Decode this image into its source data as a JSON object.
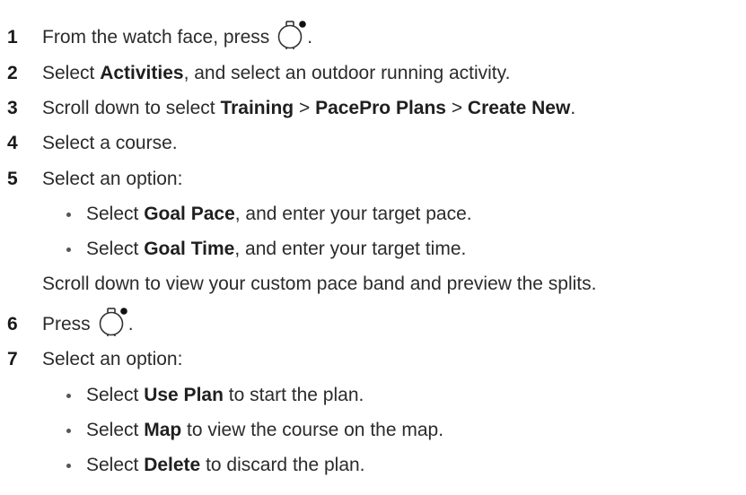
{
  "steps": [
    {
      "num": "1",
      "text": "From the watch face, press",
      "after": "."
    },
    {
      "num": "2",
      "pre": "Select ",
      "bold": "Activities",
      "post": ", and select an outdoor running activity."
    },
    {
      "num": "3",
      "pre": "Scroll down to select ",
      "b1": "Training",
      "sep1": " > ",
      "b2": "PacePro Plans",
      "sep2": " > ",
      "b3": "Create New",
      "post": "."
    },
    {
      "num": "4",
      "text": "Select a course."
    },
    {
      "num": "5",
      "text": "Select an option:"
    },
    {
      "num": "6",
      "text": "Press",
      "after": "."
    },
    {
      "num": "7",
      "text": "Select an option:"
    }
  ],
  "step5_bullets": [
    {
      "pre": "Select ",
      "bold": "Goal Pace",
      "post": ", and enter your target pace."
    },
    {
      "pre": "Select ",
      "bold": "Goal Time",
      "post": ", and enter your target time."
    }
  ],
  "step5_note": "Scroll down to view your custom pace band and preview the splits.",
  "step7_bullets": [
    {
      "pre": "Select ",
      "bold": "Use Plan",
      "post": " to start the plan."
    },
    {
      "pre": "Select ",
      "bold": "Map",
      "post": " to view the course on the map."
    },
    {
      "pre": "Select ",
      "bold": "Delete",
      "post": " to discard the plan."
    }
  ],
  "icons": {
    "button_icon": "watch-button-icon"
  }
}
